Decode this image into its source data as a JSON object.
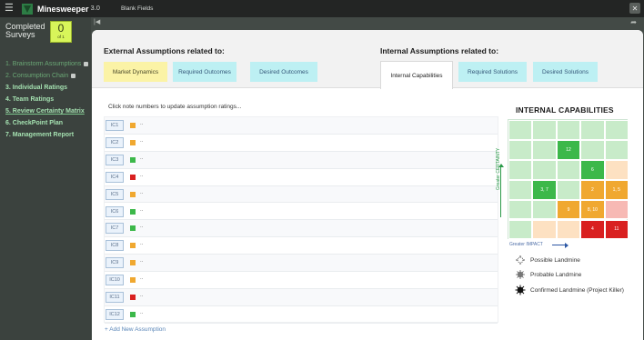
{
  "topbar": {
    "app_name": "Minesweeper",
    "version": "3.0",
    "doc_label": "Blank Fields"
  },
  "sidebar": {
    "completed_label": "Completed Surveys",
    "completed_count": "0",
    "completed_of": "of 1",
    "steps": [
      {
        "label": "1. Brainstorm Assumptions",
        "locked": true
      },
      {
        "label": "2. Consumption Chain",
        "locked": true
      },
      {
        "label": "3. Individual Ratings",
        "locked": false
      },
      {
        "label": "4. Team Ratings",
        "locked": false
      },
      {
        "label": "5. Review Certainty Matrix",
        "locked": false
      },
      {
        "label": "6. CheckPoint Plan",
        "locked": false
      },
      {
        "label": "7. Management Report",
        "locked": false
      }
    ]
  },
  "external": {
    "title": "External Assumptions related to:",
    "tabs": [
      "Market Dynamics",
      "Required Outcomes",
      "Desired Outcomes"
    ]
  },
  "internal": {
    "title": "Internal Assumptions related to:",
    "tabs": [
      "Internal Capabilities",
      "Required Solutions",
      "Desired Solutions"
    ]
  },
  "list": {
    "hint": "Click note numbers to update assumption ratings...",
    "add_new": "+ Add New Assumption",
    "rows": [
      {
        "id": "IC1",
        "status": "#f0a830",
        "text": ".."
      },
      {
        "id": "IC2",
        "status": "#f0a830",
        "text": ".."
      },
      {
        "id": "IC3",
        "status": "#3cb84a",
        "text": ".."
      },
      {
        "id": "IC4",
        "status": "#d92020",
        "text": ".."
      },
      {
        "id": "IC5",
        "status": "#f0a830",
        "text": ".."
      },
      {
        "id": "IC6",
        "status": "#3cb84a",
        "text": ".."
      },
      {
        "id": "IC7",
        "status": "#3cb84a",
        "text": ".."
      },
      {
        "id": "IC8",
        "status": "#f0a830",
        "text": ".."
      },
      {
        "id": "IC9",
        "status": "#f0a830",
        "text": ".."
      },
      {
        "id": "IC10",
        "status": "#f0a830",
        "text": ".."
      },
      {
        "id": "IC11",
        "status": "#d92020",
        "text": ".."
      },
      {
        "id": "IC12",
        "status": "#3cb84a",
        "text": ".."
      }
    ]
  },
  "matrix": {
    "title": "INTERNAL CAPABILITIES",
    "y_label": "Greater CERTAINTY",
    "x_label": "Greater IMPACT",
    "cells": [
      [
        "#c8ebc9",
        "#c8ebc9",
        "#c8ebc9",
        "#c8ebc9",
        "#c8ebc9"
      ],
      [
        "#c8ebc9",
        "#c8ebc9",
        "#3cb84a",
        "#c8ebc9",
        "#c8ebc9"
      ],
      [
        "#c8ebc9",
        "#c8ebc9",
        "#c8ebc9",
        "#3cb84a",
        "#fde1c2"
      ],
      [
        "#c8ebc9",
        "#3cb84a",
        "#c8ebc9",
        "#f0a830",
        "#f0a830"
      ],
      [
        "#c8ebc9",
        "#c8ebc9",
        "#f0a830",
        "#f0a830",
        "#f7b9b4"
      ],
      [
        "#c8ebc9",
        "#fde1c2",
        "#fde1c2",
        "#d92020",
        "#d92020"
      ]
    ],
    "labels": [
      [
        "",
        "",
        "",
        "",
        ""
      ],
      [
        "",
        "",
        "12",
        "",
        ""
      ],
      [
        "",
        "",
        "",
        "6",
        ""
      ],
      [
        "",
        "3, 7",
        "",
        "2",
        "1, 5"
      ],
      [
        "",
        "",
        "9",
        "8, 10",
        ""
      ],
      [
        "",
        "",
        "",
        "4",
        "11"
      ]
    ],
    "legend": [
      "Possible Landmine",
      "Probable Landmine",
      "Confirmed Landmine (Project Killer)"
    ]
  }
}
